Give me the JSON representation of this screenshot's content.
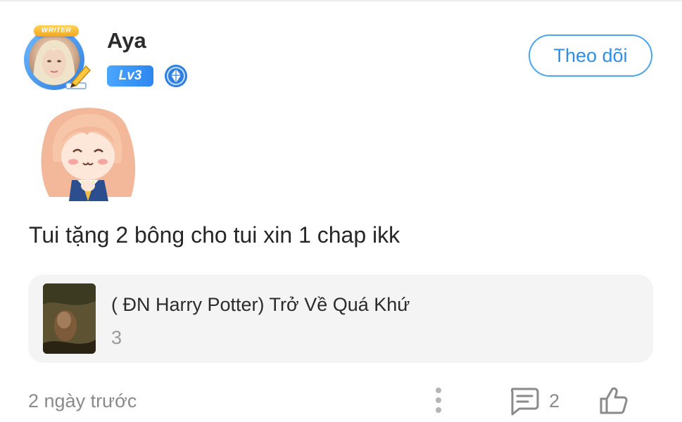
{
  "post": {
    "author": {
      "name": "Aya",
      "frame_label": "WRITER",
      "level": "Lv3"
    },
    "follow_label": "Theo dõi",
    "text": "Tui tặng 2 bông cho tui xin 1 chap ikk",
    "book": {
      "title": "( ĐN Harry Potter) Trở Về Quá Khứ",
      "count": "3"
    },
    "time": "2 ngày trước",
    "comment_count": "2"
  },
  "colors": {
    "accent": "#2f8fe6",
    "muted": "#8a8a8a",
    "card_bg": "#f4f4f5"
  },
  "icons": [
    "pen-icon",
    "rank-diamond-icon",
    "more-vertical-icon",
    "comment-icon",
    "thumbs-up-icon"
  ]
}
